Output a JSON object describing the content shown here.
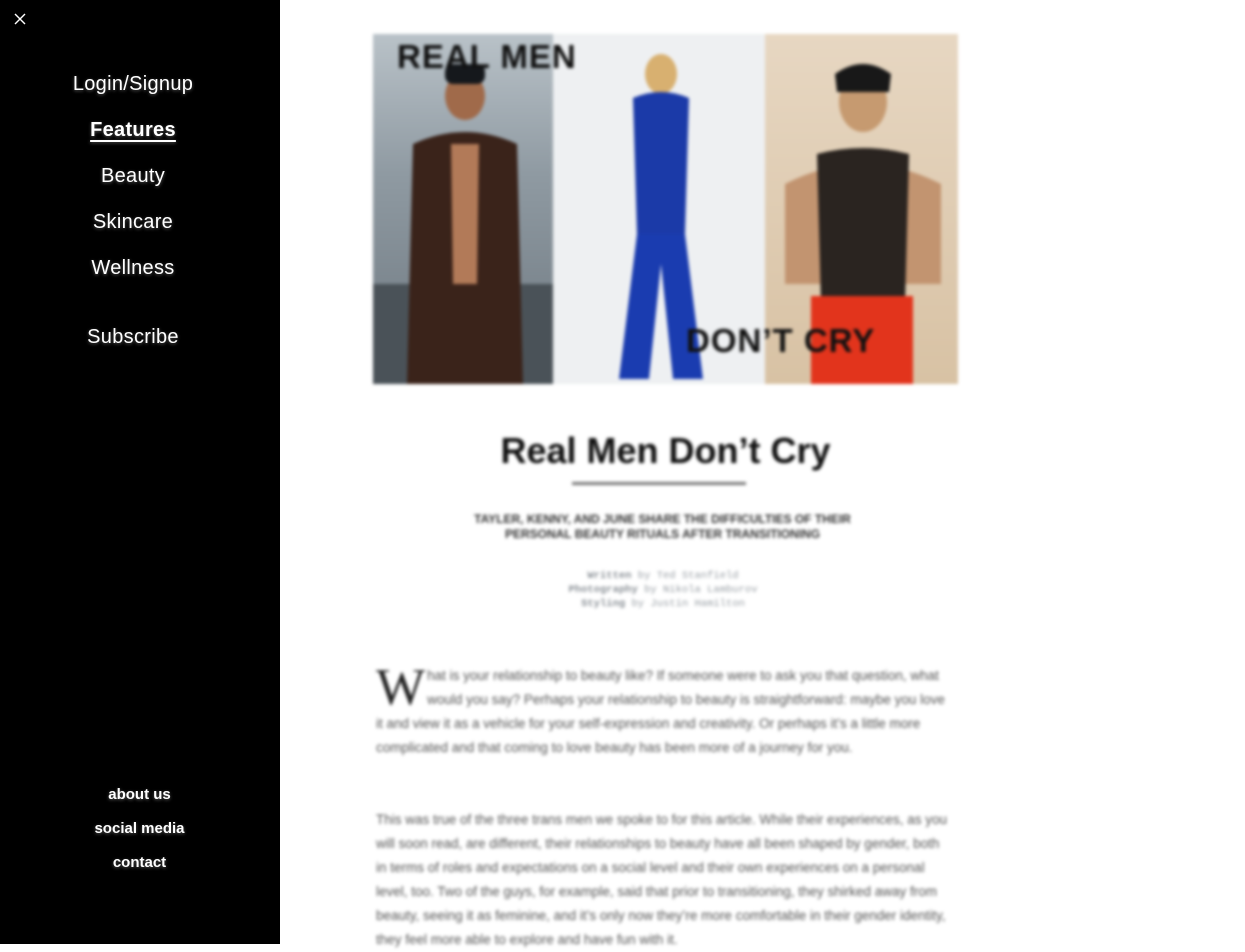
{
  "sidebar": {
    "nav": {
      "login_signup": "Login/Signup",
      "features": "Features",
      "beauty": "Beauty",
      "skincare": "Skincare",
      "wellness": "Wellness",
      "subscribe": "Subscribe"
    },
    "footer": {
      "about_us": "about us",
      "social_media": "social media",
      "contact": "contact"
    },
    "background_color": "#000000",
    "text_color": "#ffffff"
  },
  "article": {
    "hero_text_top": "REAL MEN",
    "hero_text_bottom": "DON’T CRY",
    "title": "Real Men Don’t Cry",
    "subtitle": "TAYLER, KENNY, AND JUNE SHARE THE DIFFICULTIES OF THEIR PERSONAL BEAUTY RITUALS AFTER TRANSITIONING",
    "credits": {
      "written_label": "Written",
      "written_by": "by Ted Stanfield",
      "photography_label": "Photography",
      "photography_by": "by Nikola Lamburov",
      "styling_label": "Styling",
      "styling_by": "by Justin Hamilton"
    },
    "drop_cap": "W",
    "paragraph_1": "hat is your relationship to beauty like? If someone were to ask you that question, what would you say? Perhaps your relationship to beauty is straightforward: maybe you love it and view it as a vehicle for your self-expression and creativity. Or perhaps it’s a little more complicated and that coming to love beauty has been more of a journey for you.",
    "paragraph_2": "This was true of the three trans men we spoke to for this article. While their experiences, as you will soon read, are different, their relationships to beauty have all been shaped by gender, both in terms of roles and expectations on a social level and their own experiences on a personal level, too. Two of the guys, for example, said that prior to transitioning, they shirked away from beauty, seeing it as feminine, and it’s only now they’re more comfortable in their gender identity, they feel more able to explore and have fun with it."
  }
}
